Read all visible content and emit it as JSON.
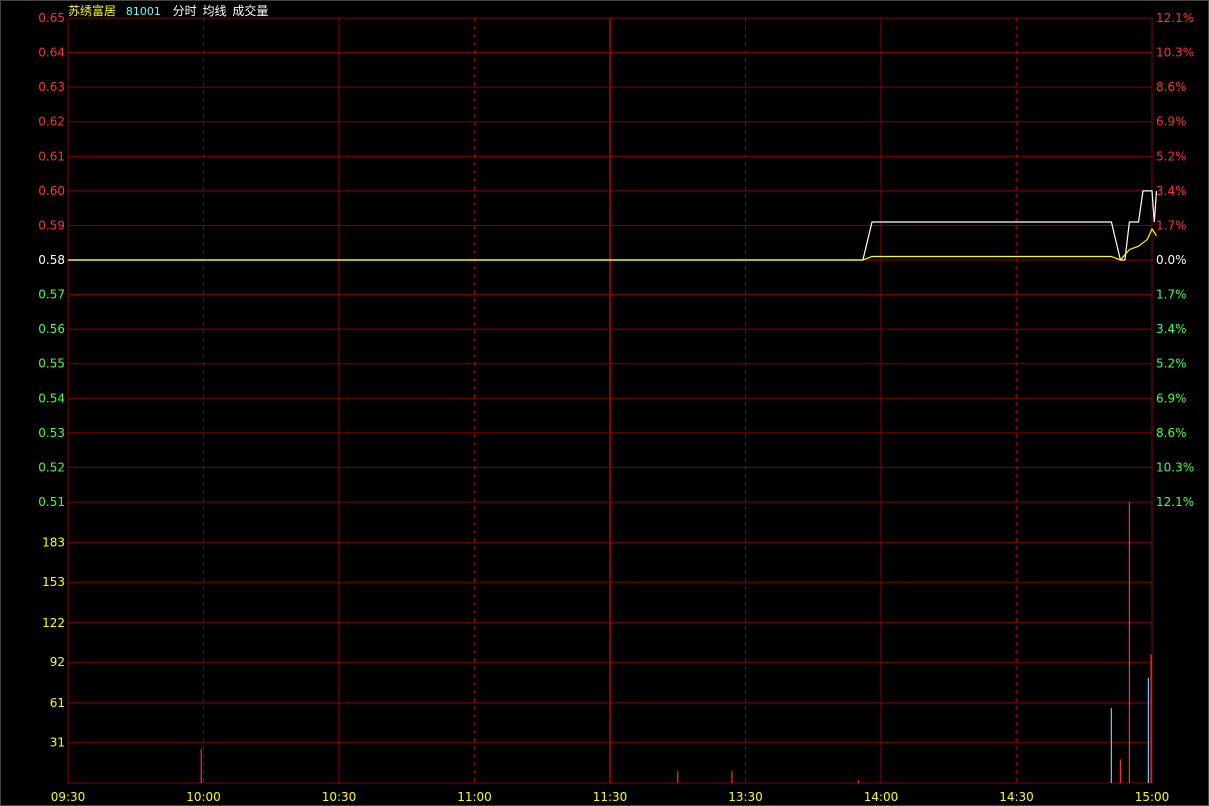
{
  "header": {
    "stock_name": "苏绣富居",
    "stock_code": "81001",
    "indicator_1": "分时",
    "indicator_2": "均线",
    "indicator_3": "成交量"
  },
  "colors": {
    "background": "#000000",
    "grid": "#8B0000",
    "up": "#FF3030",
    "down": "#44FF44",
    "flat": "#FFFFFF",
    "price_line": "#FFFFFF",
    "avg_line": "#FFFF00",
    "volume_label": "#FFFF00",
    "time_label": "#FFFF00",
    "stock_name": "#FFFF00",
    "stock_code": "#66FFFF"
  },
  "chart_data": {
    "type": "line",
    "title": "",
    "price_axis": {
      "ticks": [
        "0.65",
        "0.64",
        "0.63",
        "0.62",
        "0.61",
        "0.60",
        "0.59",
        "0.58",
        "0.57",
        "0.56",
        "0.55",
        "0.54",
        "0.53",
        "0.52",
        "0.51"
      ],
      "ylim": [
        0.51,
        0.65
      ],
      "prev_close": 0.58
    },
    "pct_axis": {
      "ticks": [
        "12.1%",
        "10.3%",
        "8.6%",
        "6.9%",
        "5.2%",
        "3.4%",
        "1.7%",
        "0.0%",
        "1.7%",
        "3.4%",
        "5.2%",
        "6.9%",
        "8.6%",
        "10.3%",
        "12.1%"
      ]
    },
    "volume_axis": {
      "ticks": [
        "183",
        "153",
        "122",
        "92",
        "61",
        "31"
      ],
      "ylim": [
        0,
        214
      ]
    },
    "time_axis": {
      "ticks": [
        "09:30",
        "10:00",
        "10:30",
        "11:00",
        "11:30",
        "13:30",
        "14:00",
        "14:30",
        "15:00"
      ],
      "total_minutes": 240
    },
    "series": [
      {
        "name": "分时",
        "points": [
          [
            0,
            0.58
          ],
          [
            176,
            0.58
          ],
          [
            178,
            0.591
          ],
          [
            231,
            0.591
          ],
          [
            233,
            0.58
          ],
          [
            234,
            0.58
          ],
          [
            235,
            0.591
          ],
          [
            237,
            0.591
          ],
          [
            238,
            0.6
          ],
          [
            240,
            0.6
          ],
          [
            240.5,
            0.591
          ],
          [
            241,
            0.6
          ]
        ]
      },
      {
        "name": "均线",
        "points": [
          [
            0,
            0.58
          ],
          [
            176,
            0.58
          ],
          [
            178,
            0.581
          ],
          [
            231,
            0.581
          ],
          [
            233,
            0.58
          ],
          [
            235,
            0.583
          ],
          [
            237,
            0.584
          ],
          [
            239,
            0.586
          ],
          [
            240,
            0.589
          ],
          [
            241,
            0.587
          ]
        ]
      }
    ],
    "volume": [
      {
        "t": 29.5,
        "v": 26,
        "dir": "up"
      },
      {
        "t": 135,
        "v": 9,
        "dir": "up"
      },
      {
        "t": 147,
        "v": 9,
        "dir": "up"
      },
      {
        "t": 175,
        "v": 2,
        "dir": "up"
      },
      {
        "t": 231,
        "v": 57,
        "dir": "flat"
      },
      {
        "t": 233,
        "v": 18,
        "dir": "up"
      },
      {
        "t": 235,
        "v": 214,
        "dir": "up"
      },
      {
        "t": 239.2,
        "v": 80,
        "dir": "flat"
      },
      {
        "t": 239.8,
        "v": 98,
        "dir": "up"
      }
    ]
  }
}
